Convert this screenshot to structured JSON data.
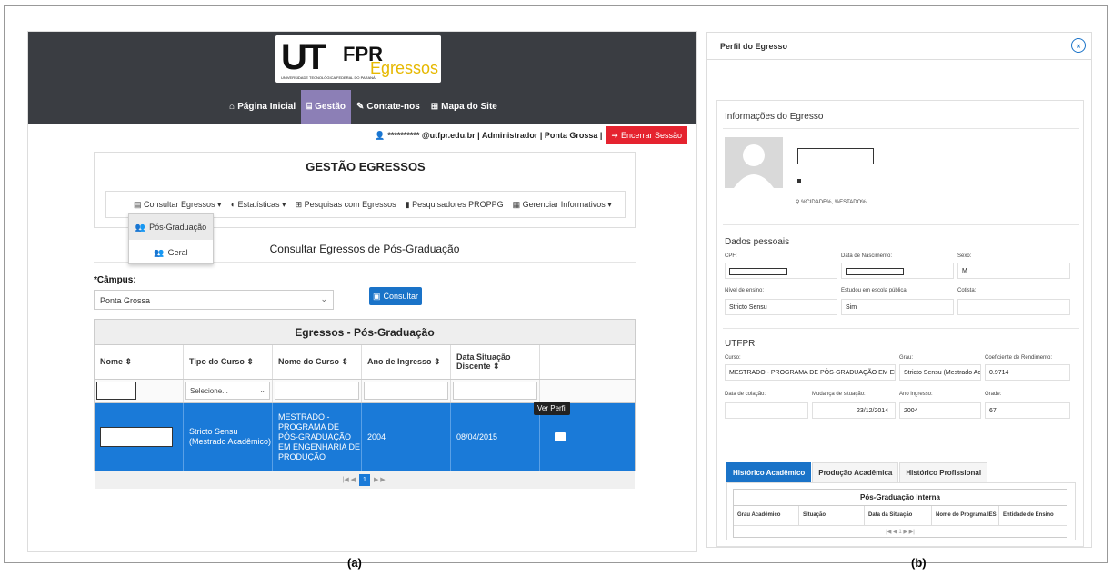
{
  "captions": {
    "a": "(a)",
    "b": "(b)"
  },
  "header": {
    "logo": {
      "ut": "UT",
      "fpr": "FPR",
      "egressos": "Egressos",
      "subtitle": "UNIVERSIDADE TECNOLÓGICA FEDERAL DO PARANÁ"
    },
    "nav": [
      {
        "icon": "home-icon",
        "glyph": "⌂",
        "label": "Página Inicial"
      },
      {
        "icon": "institution-icon",
        "glyph": "⌸",
        "label": "Gestão"
      },
      {
        "icon": "edit-icon",
        "glyph": "✎",
        "label": "Contate-nos"
      },
      {
        "icon": "sitemap-icon",
        "glyph": "⊞",
        "label": "Mapa do Site"
      }
    ],
    "active_nav": "Gestão"
  },
  "userbar": {
    "user": "********** @utfpr.edu.br | Administrador | Ponta Grossa |",
    "logout": "Encerrar Sessão"
  },
  "gestao": {
    "title": "GESTÃO EGRESSOS",
    "menu": [
      "Consultar Egressos ▾",
      "Estatísticas ▾",
      "Pesquisas com Egressos",
      "Pesquisadores PROPPG",
      "Gerenciar Informativos ▾"
    ],
    "dropdown": [
      "Pós-Graduação",
      "Geral"
    ]
  },
  "consulta": {
    "title": "Consultar Egressos de Pós-Graduação",
    "campus_label": "*Câmpus:",
    "campus_value": "Ponta Grossa",
    "button": "Consultar"
  },
  "table": {
    "title": "Egressos - Pós-Graduação",
    "columns": [
      "Nome ⇕",
      "Tipo do Curso ⇕",
      "Nome do Curso ⇕",
      "Ano de Ingresso ⇕",
      "Data Situação Discente ⇕",
      ""
    ],
    "filter_select": "Selecione...",
    "row": {
      "tipo": "Stricto Sensu (Mestrado Acadêmico)",
      "curso": "MESTRADO - PROGRAMA DE PÓS-GRADUAÇÃO EM ENGENHARIA DE PRODUÇÃO",
      "ano": "2004",
      "data": "08/04/2015"
    },
    "tooltip": "Ver Perfil",
    "page": "1"
  },
  "perfil": {
    "title": "Perfil do Egresso",
    "info_title": "Informações do Egresso",
    "location": "%CIDADE%, %ESTADO%",
    "pessoais_title": "Dados pessoais",
    "labels": {
      "cpf": "CPF:",
      "nasc": "Data de Nascimento:",
      "sexo": "Sexo:",
      "nivel": "Nível de ensino:",
      "escola": "Estudou em escola pública:",
      "cotista": "Cotista:"
    },
    "values": {
      "sexo": "M",
      "nivel": "Stricto Sensu",
      "escola": "Sim"
    },
    "utfpr_title": "UTFPR",
    "utfpr_labels": {
      "curso": "Curso:",
      "grau": "Grau:",
      "coef": "Coeficiente de Rendimento:",
      "colacao": "Data de colação:",
      "mudanca": "Mudança de situação:",
      "ingresso": "Ano ingresso:",
      "grade": "Grade:"
    },
    "utfpr_values": {
      "curso": "MESTRADO - PROGRAMA DE PÓS-GRADUAÇÃO EM ENGENH",
      "grau": "Stricto Sensu (Mestrado Ac",
      "coef": "0.9714",
      "mudanca": "23/12/2014",
      "ingresso": "2004",
      "grade": "67"
    },
    "tabs": [
      "Histórico Acadêmico",
      "Produção Acadêmica",
      "Histórico Profissional"
    ],
    "hist_title": "Pós-Graduação Interna",
    "hist_cols": [
      "Grau Acadêmico",
      "Situação",
      "Data da Situação",
      "Nome do Programa IES",
      "Entidade de Ensino"
    ]
  }
}
